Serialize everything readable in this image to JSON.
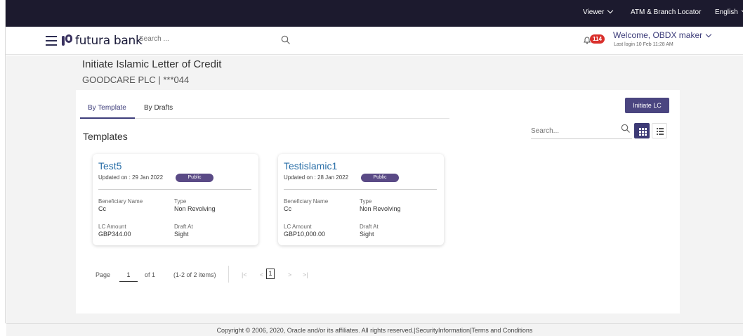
{
  "topbar": {
    "viewer_label": "Viewer",
    "atm_label": "ATM & Branch Locator",
    "language_label": "English"
  },
  "header": {
    "logo_text": "futura bank",
    "search_placeholder": "Search ...",
    "notification_count": "114",
    "welcome_text": "Welcome, OBDX maker",
    "last_login": "Last login 10 Feb 11:28 AM"
  },
  "page": {
    "title": "Initiate Islamic Letter of Credit",
    "account": "GOODCARE PLC | ***044"
  },
  "tabs": [
    {
      "label": "By Template",
      "active": true
    },
    {
      "label": "By Drafts",
      "active": false
    }
  ],
  "actions": {
    "initiate_label": "Initiate LC"
  },
  "templates_section": {
    "title": "Templates",
    "search_placeholder": "Search..."
  },
  "templates": [
    {
      "name": "Test5",
      "updated": "Updated on : 29 Jan 2022",
      "badge": "Public",
      "beneficiary_label": "Beneficiary Name",
      "beneficiary": "Cc",
      "type_label": "Type",
      "type": "Non Revolving",
      "amount_label": "LC Amount",
      "amount": "GBP344.00",
      "draft_label": "Draft At",
      "draft": "Sight"
    },
    {
      "name": "Testislamic1",
      "updated": "Updated on : 28 Jan 2022",
      "badge": "Public",
      "beneficiary_label": "Beneficiary Name",
      "beneficiary": "Cc",
      "type_label": "Type",
      "type": "Non Revolving",
      "amount_label": "LC Amount",
      "amount": "GBP10,000.00",
      "draft_label": "Draft At",
      "draft": "Sight"
    }
  ],
  "pagination": {
    "page_label": "Page",
    "page_number": "1",
    "of_label": "of 1",
    "items_label": "(1-2 of 2 items)",
    "first": "|<",
    "prev": "<",
    "current": "1",
    "next": ">",
    "last": ">|"
  },
  "footer": {
    "text": "Copyright © 2006, 2020, Oracle and/or its affiliates. All rights reserved.|SecurityInformation|Terms and Conditions"
  },
  "colors": {
    "topbar": "#1c1a2e",
    "primary": "#4a4580",
    "link": "#2a6fa8",
    "badge": "#5a4a86",
    "notification": "#d9302c"
  },
  "icons": [
    "hamburger-icon",
    "search-icon",
    "bell-icon",
    "chevron-down-icon",
    "grid-view-icon",
    "list-view-icon"
  ]
}
